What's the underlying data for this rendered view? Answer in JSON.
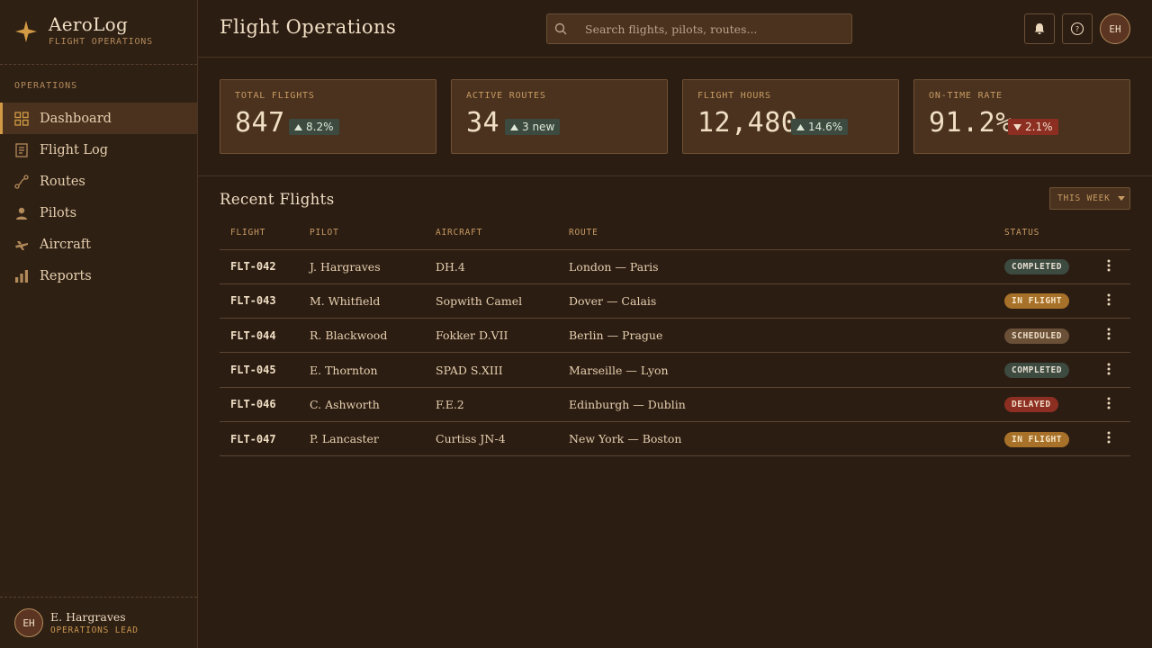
{
  "brand": {
    "title": "AeroLog",
    "subtitle": "FLIGHT OPERATIONS",
    "icon": "compass-star-icon"
  },
  "sidebar": {
    "section_label": "OPERATIONS",
    "items": [
      {
        "label": "Dashboard",
        "icon": "grid-icon",
        "active": true
      },
      {
        "label": "Flight Log",
        "icon": "document-icon"
      },
      {
        "label": "Routes",
        "icon": "route-icon"
      },
      {
        "label": "Pilots",
        "icon": "person-icon"
      },
      {
        "label": "Aircraft",
        "icon": "plane-icon"
      },
      {
        "label": "Reports",
        "icon": "bar-chart-icon"
      }
    ],
    "user": {
      "initials": "EH",
      "name": "E. Hargraves",
      "role": "OPERATIONS LEAD"
    }
  },
  "header": {
    "title": "Flight Operations",
    "search_placeholder": "Search flights, pilots, routes...",
    "avatar_initials": "EH"
  },
  "stats": [
    {
      "label": "TOTAL FLIGHTS",
      "value": "847",
      "delta": "8.2%",
      "direction": "up"
    },
    {
      "label": "ACTIVE ROUTES",
      "value": "34",
      "delta": "3 new",
      "direction": "up"
    },
    {
      "label": "FLIGHT HOURS",
      "value": "12,480",
      "delta": "14.6%",
      "direction": "up"
    },
    {
      "label": "ON-TIME RATE",
      "value": "91.2%",
      "delta": "2.1%",
      "direction": "down"
    }
  ],
  "recent": {
    "title": "Recent Flights",
    "filter": "THIS WEEK",
    "columns": [
      "FLIGHT",
      "PILOT",
      "AIRCRAFT",
      "ROUTE",
      "STATUS"
    ],
    "rows": [
      {
        "flight": "FLT-042",
        "pilot": "J. Hargraves",
        "aircraft": "DH.4",
        "route": "London — Paris",
        "status": "COMPLETED"
      },
      {
        "flight": "FLT-043",
        "pilot": "M. Whitfield",
        "aircraft": "Sopwith Camel",
        "route": "Dover — Calais",
        "status": "IN FLIGHT"
      },
      {
        "flight": "FLT-044",
        "pilot": "R. Blackwood",
        "aircraft": "Fokker D.VII",
        "route": "Berlin — Prague",
        "status": "SCHEDULED"
      },
      {
        "flight": "FLT-045",
        "pilot": "E. Thornton",
        "aircraft": "SPAD S.XIII",
        "route": "Marseille — Lyon",
        "status": "COMPLETED"
      },
      {
        "flight": "FLT-046",
        "pilot": "C. Ashworth",
        "aircraft": "F.E.2",
        "route": "Edinburgh — Dublin",
        "status": "DELAYED"
      },
      {
        "flight": "FLT-047",
        "pilot": "P. Lancaster",
        "aircraft": "Curtiss JN-4",
        "route": "New York — Boston",
        "status": "IN FLIGHT"
      }
    ]
  },
  "colors": {
    "accent": "#d39a45",
    "completed": "#3c4a40",
    "in_flight": "#a7712a",
    "scheduled": "#6b5038",
    "delayed": "#8c2f22"
  }
}
